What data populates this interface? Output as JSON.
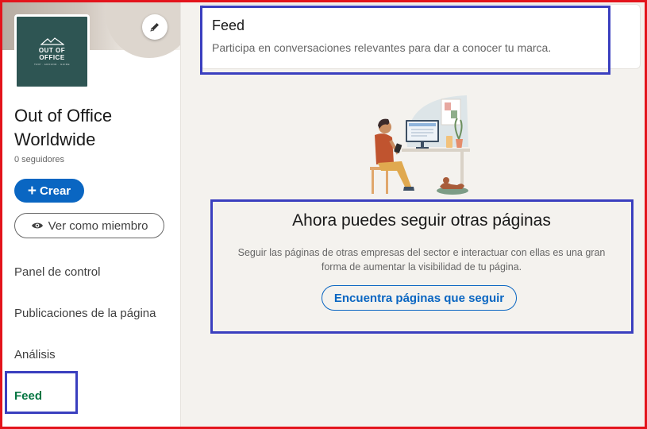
{
  "sidebar": {
    "logo": {
      "line1": "OUT OF",
      "line2": "OFFICE",
      "small": "TRIP · AROUND · GUIDE"
    },
    "company_name": "Out of Office Worldwide",
    "followers": "0 seguidores",
    "create_label": "Crear",
    "view_as_member_label": "Ver como miembro",
    "nav": [
      {
        "label": "Panel de control"
      },
      {
        "label": "Publicaciones de la página"
      },
      {
        "label": "Análisis"
      },
      {
        "label": "Feed"
      }
    ]
  },
  "feed_card": {
    "title": "Feed",
    "subtitle": "Participa en conversaciones relevantes para dar a conocer tu marca."
  },
  "empty_state": {
    "heading": "Ahora puedes seguir otras páginas",
    "description_line1": "Seguir las páginas de otras empresas del sector e interactuar con ellas es una gran",
    "description_line2": "forma de aumentar la visibilidad de tu página.",
    "button_label": "Encuentra páginas que seguir"
  },
  "icons": {
    "edit": "pencil-icon",
    "create": "plus-icon",
    "view": "eye-icon"
  },
  "colors": {
    "primary_blue": "#0a66c2",
    "active_green": "#057642",
    "annotation_red": "#e3141c",
    "annotation_blue": "#3a3fbf",
    "logo_teal": "#2e5553"
  }
}
